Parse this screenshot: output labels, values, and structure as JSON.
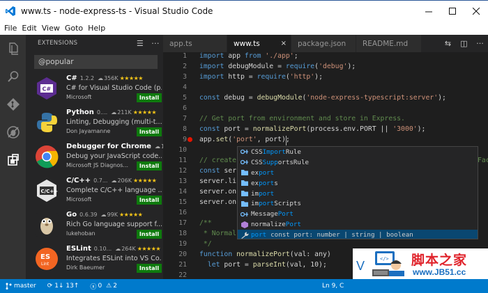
{
  "window": {
    "title": "www.ts - node-express-ts - Visual Studio Code",
    "controls": [
      "minimize",
      "maximize",
      "close"
    ]
  },
  "menu": [
    "File",
    "Edit",
    "View",
    "Goto",
    "Help"
  ],
  "activity_bar": [
    "explorer-icon",
    "search-icon",
    "git-icon",
    "debug-icon",
    "extensions-icon"
  ],
  "sidebar": {
    "header": "EXTENSIONS",
    "search_value": "@popular",
    "extensions": [
      {
        "name": "C#",
        "version": "1.2.2",
        "downloads": "356K",
        "stars": "★★★★★",
        "desc": "C# for Visual Studio Code (p...",
        "publisher": "Microsoft",
        "install": "Install",
        "logo": "csharp",
        "color": "#5c2d91"
      },
      {
        "name": "Python",
        "version": "0....",
        "downloads": "211K",
        "stars": "★★★★★",
        "desc": "Linting, Debugging (multi-t...",
        "publisher": "Don Jayamanne",
        "install": "Install",
        "logo": "python",
        "color": "#3572a5"
      },
      {
        "name": "Debugger for Chrome",
        "version": "",
        "downloads": "148",
        "stars": "",
        "desc": "Debug your JavaScript code...",
        "publisher": "Microsoft JS Diagnos...",
        "install": "Install",
        "logo": "chrome",
        "color": "#db4437"
      },
      {
        "name": "C/C++",
        "version": "0.7...",
        "downloads": "206K",
        "stars": "★★★★★",
        "desc": "Complete C/C++ language ...",
        "publisher": "Microsoft",
        "install": "Install",
        "logo": "cpp",
        "color": "#e5e5e5"
      },
      {
        "name": "Go",
        "version": "0.6.39",
        "downloads": "99K",
        "stars": "★★★★★",
        "desc": "Rich Go language support f...",
        "publisher": "lukehoban",
        "install": "Install",
        "logo": "go",
        "color": "#6ad7e5"
      },
      {
        "name": "ESLint",
        "version": "0.10...",
        "downloads": "264K",
        "stars": "★★★★★",
        "desc": "Integrates ESLint into VS Co...",
        "publisher": "Dirk Baeumer",
        "install": "Install",
        "logo": "eslint",
        "color": "#f26522"
      }
    ]
  },
  "tabs": [
    {
      "label": "app.ts",
      "active": false
    },
    {
      "label": "www.ts",
      "active": true,
      "close": "×"
    },
    {
      "label": "package.json",
      "active": false
    },
    {
      "label": "README.md",
      "active": false
    }
  ],
  "tab_actions": [
    "open-changes-icon",
    "split-editor-icon",
    "more-icon"
  ],
  "editor": {
    "lines": [
      {
        "n": "1",
        "t": "import app from './app';"
      },
      {
        "n": "2",
        "t": "import debugModule = require('debug');"
      },
      {
        "n": "3",
        "t": "import http = require('http');"
      },
      {
        "n": "4",
        "t": ""
      },
      {
        "n": "5",
        "t": "const debug = debugModule('node-express-typescript:server');"
      },
      {
        "n": "6",
        "t": ""
      },
      {
        "n": "7",
        "t": "// Get port from environment and store in Express."
      },
      {
        "n": "8",
        "t": "const port = normalizePort(process.env.PORT || '3000');"
      },
      {
        "n": "9",
        "t": "app.set('port', port);"
      },
      {
        "n": "10",
        "t": ""
      },
      {
        "n": "11",
        "t": "// create"
      },
      {
        "n": "12",
        "t": "const ser"
      },
      {
        "n": "13",
        "t": "server.li"
      },
      {
        "n": "14",
        "t": "server.on"
      },
      {
        "n": "15",
        "t": "server.on"
      },
      {
        "n": "16",
        "t": ""
      },
      {
        "n": "17",
        "t": "/**"
      },
      {
        "n": "18",
        "t": " * Normal"
      },
      {
        "n": "19",
        "t": " */"
      },
      {
        "n": "20",
        "t": "function normalizePort(val: any)"
      },
      {
        "n": "21",
        "t": "  let port = parseInt(val, 10);"
      },
      {
        "n": "22",
        "t": ""
      }
    ],
    "overflow_hint": "Fac"
  },
  "suggest": {
    "prefix": "port",
    "items": [
      {
        "icon": "ref",
        "pre": "CSS",
        "match": "Import",
        "post": "Rule",
        "selected": false
      },
      {
        "icon": "ref",
        "pre": "CSS",
        "match": "Supp",
        "post": "ortsRule",
        "selected": false
      },
      {
        "icon": "mod",
        "pre": "ex",
        "match": "port",
        "post": "",
        "selected": false
      },
      {
        "icon": "mod",
        "pre": "ex",
        "match": "port",
        "post": "s",
        "selected": false
      },
      {
        "icon": "mod",
        "pre": "im",
        "match": "port",
        "post": "",
        "selected": false
      },
      {
        "icon": "mod",
        "pre": "im",
        "match": "port",
        "post": "Scripts",
        "selected": false
      },
      {
        "icon": "ref",
        "pre": "Message",
        "match": "Port",
        "post": "",
        "selected": false
      },
      {
        "icon": "cls",
        "pre": "normalize",
        "match": "Port",
        "post": "",
        "selected": false
      },
      {
        "icon": "wrench",
        "pre": "",
        "match": "port",
        "post": "",
        "detail": "const port: number | string | boolean",
        "selected": true
      }
    ]
  },
  "status": {
    "branch": "master",
    "sync": "1↓ 13↑",
    "errors": "0",
    "warnings": "2",
    "position": "Ln 9, C"
  },
  "watermark": {
    "brand": "脚本之家",
    "url": "www.JB51.cc"
  },
  "colors": {
    "accent": "#007acc",
    "install": "#0e7a0d",
    "selection": "#094771",
    "breakpoint": "#e51400"
  }
}
